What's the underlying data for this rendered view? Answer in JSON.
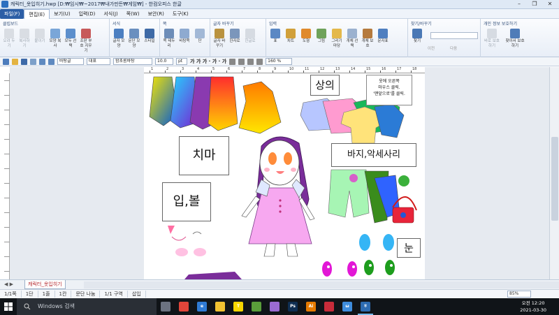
{
  "window": {
    "title": "캐릭터_옷입히기.hwp [D:₩임시₩~2017₩내가만든₩게임₩] - 한컴오피스 한글",
    "controls": [
      "–",
      "❐",
      "✕"
    ]
  },
  "menu": {
    "items": [
      "파일(F)",
      "편집(E)",
      "보기(U)",
      "입력(D)",
      "서식(J)",
      "쪽(W)",
      "보안(R)",
      "도구(K)"
    ]
  },
  "ribbon": {
    "groups": [
      {
        "title": "클립보드",
        "buttons": [
          "오려 두기",
          "복사하기",
          "붙이기",
          "모양 복사",
          "모두 선택",
          "조판 부호 지우기"
        ]
      },
      {
        "title": "서식",
        "buttons": [
          "글자 모양",
          "문단 모양",
          "스타일"
        ]
      },
      {
        "title": "쪽",
        "buttons": [
          "쪽 테두리",
          "바탕쪽",
          "단"
        ]
      },
      {
        "title": "글자 바꾸기",
        "buttons": [
          "글자 바꾸기",
          "한자로",
          "한글로"
        ]
      },
      {
        "title": "입력",
        "buttons": [
          "표",
          "차트",
          "도형",
          "그림",
          "그리기마당",
          "개체 선택",
          "개체 보호",
          "문자표"
        ]
      },
      {
        "title": "찾기/바꾸기",
        "buttons": [
          "찾기",
          "이전",
          "다음"
        ]
      },
      {
        "title": "개인 정보 보호하기",
        "buttons": [
          "바로 보호하기",
          "찾아서 보호하기"
        ]
      }
    ]
  },
  "toolbar": {
    "style": "바탕글",
    "lang": "대표",
    "font": "함초롬바탕",
    "size": "10.0",
    "unit": "pt",
    "font_buttons": "가 가 가 · 가 · 가",
    "zoom": "160 %"
  },
  "ruler": {
    "labels": [
      "1",
      "2",
      "3",
      "4",
      "5",
      "6",
      "7",
      "8",
      "9",
      "10",
      "11",
      "12",
      "13",
      "14",
      "15",
      "16",
      "17",
      "18"
    ]
  },
  "document": {
    "labels": {
      "top": "상의",
      "skirt": "치마",
      "lips": "입,볼",
      "pants": "바지,악세사리",
      "eyes": "눈"
    },
    "note": [
      "옷에 오른쪽",
      "마우스 클릭.",
      "'맨앞으로'를 클릭."
    ]
  },
  "tabs": {
    "nav": "◀ ▶",
    "doc_tab": "캐릭터_옷입히기"
  },
  "status": {
    "segments": [
      "1/1쪽",
      "1단",
      "1줄",
      "1칸",
      "문단 나눔",
      "1/1 구역",
      "삽입"
    ],
    "zoom": "85%"
  },
  "taskbar": {
    "search": "Windows 검색",
    "apps": [
      {
        "name": "task-view",
        "label": "",
        "color": "#6b7280"
      },
      {
        "name": "chrome",
        "label": "",
        "color": "#e0453a"
      },
      {
        "name": "edge",
        "label": "e",
        "color": "#2f7ad3"
      },
      {
        "name": "file-explorer",
        "label": "",
        "color": "#f1c232"
      },
      {
        "name": "kakaotalk",
        "label": "T",
        "color": "#f7d600"
      },
      {
        "name": "minecraft",
        "label": "",
        "color": "#5a9e3a"
      },
      {
        "name": "game",
        "label": "",
        "color": "#9a6bd1"
      },
      {
        "name": "photoshop",
        "label": "Ps",
        "color": "#0f2e52"
      },
      {
        "name": "illustrator",
        "label": "Ai",
        "color": "#e57a00"
      },
      {
        "name": "app",
        "label": "",
        "color": "#c72c3a"
      },
      {
        "name": "whale",
        "label": "ω",
        "color": "#3e8dde"
      },
      {
        "name": "hangul",
        "label": "ㅎ",
        "color": "#2d6cb2"
      }
    ],
    "time": "오전 12:20",
    "date": "2021-03-30"
  }
}
